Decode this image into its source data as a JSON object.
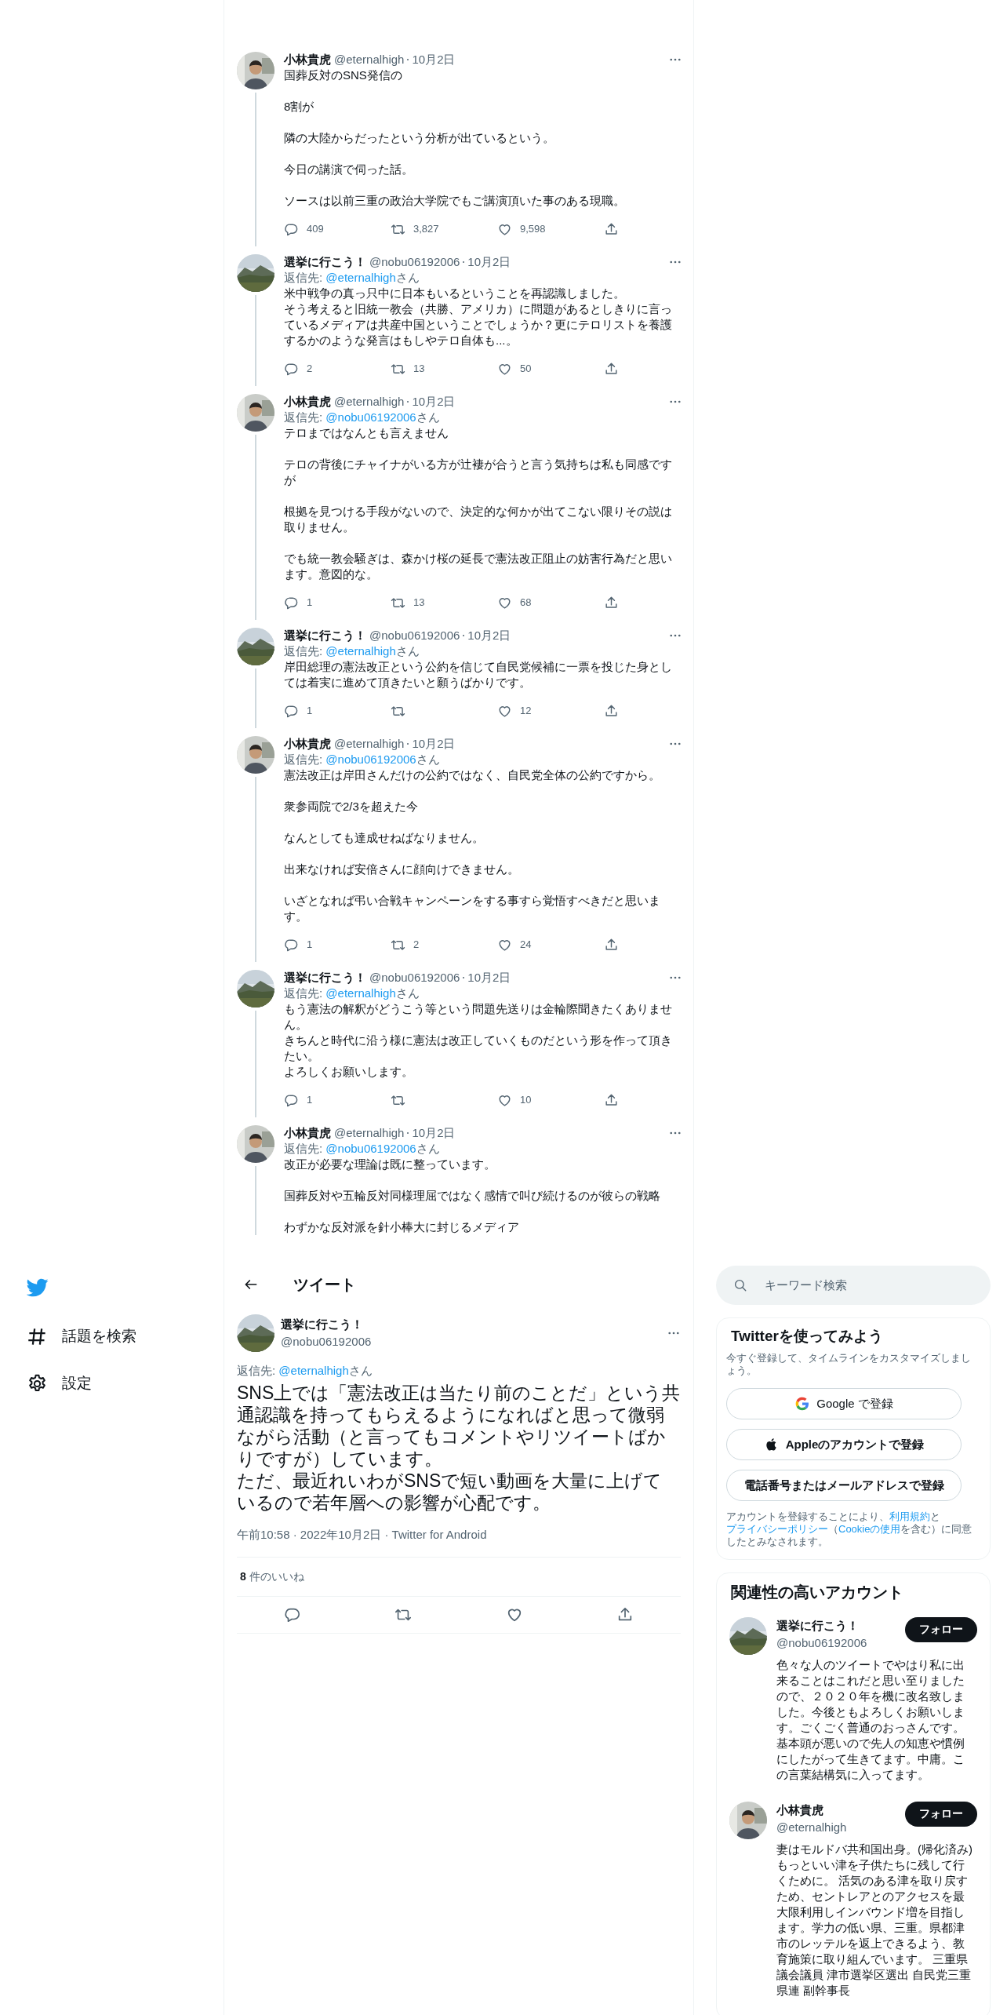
{
  "thread": [
    {
      "author": "小林貴虎",
      "handle": "@eternalhigh",
      "date": "10月2日",
      "paragraphs": [
        [
          "国葬反対のSNS発信の"
        ],
        [
          "8割が"
        ],
        [
          "隣の大陸からだったという分析が出ているという。"
        ],
        [
          "今日の講演で伺った話。"
        ],
        [
          "ソースは以前三重の政治大学院でもご講演頂いた事のある現職。"
        ]
      ],
      "stats": {
        "replies": "409",
        "retweets": "3,827",
        "likes": "9,598"
      }
    },
    {
      "author": "選挙に行こう！",
      "handle": "@nobu06192006",
      "date": "10月2日",
      "reply_to": {
        "prefix": "返信先: ",
        "handle": "@eternalhigh",
        "suffix": "さん"
      },
      "paragraphs": [
        [
          "米中戦争の真っ只中に日本もいるということを再認識しました。",
          "そう考えると旧統一教会（共勝、アメリカ）に問題があるとしきりに言っているメディアは共産中国ということでしょうか？更にテロリストを養護するかのような発言はもしやテロ自体も...。"
        ]
      ],
      "stats": {
        "replies": "2",
        "retweets": "13",
        "likes": "50"
      }
    },
    {
      "author": "小林貴虎",
      "handle": "@eternalhigh",
      "date": "10月2日",
      "reply_to": {
        "prefix": "返信先: ",
        "handle": "@nobu06192006",
        "suffix": "さん"
      },
      "paragraphs": [
        [
          "テロまではなんとも言えません"
        ],
        [
          "テロの背後にチャイナがいる方が辻褄が合うと言う気持ちは私も同感ですが"
        ],
        [
          "根拠を見つける手段がないので、決定的な何かが出てこない限りその説は取りません。"
        ],
        [
          "でも統一教会騒ぎは、森かけ桜の延長で憲法改正阻止の妨害行為だと思います。意図的な。"
        ]
      ],
      "stats": {
        "replies": "1",
        "retweets": "13",
        "likes": "68"
      }
    },
    {
      "author": "選挙に行こう！",
      "handle": "@nobu06192006",
      "date": "10月2日",
      "reply_to": {
        "prefix": "返信先: ",
        "handle": "@eternalhigh",
        "suffix": "さん"
      },
      "paragraphs": [
        [
          "岸田総理の憲法改正という公約を信じて自民党候補に一票を投じた身としては着実に進めて頂きたいと願うばかりです。"
        ]
      ],
      "stats": {
        "replies": "1",
        "likes": "12"
      }
    },
    {
      "author": "小林貴虎",
      "handle": "@eternalhigh",
      "date": "10月2日",
      "reply_to": {
        "prefix": "返信先: ",
        "handle": "@nobu06192006",
        "suffix": "さん"
      },
      "paragraphs": [
        [
          "憲法改正は岸田さんだけの公約ではなく、自民党全体の公約ですから。"
        ],
        [
          "衆参両院で2/3を超えた今"
        ],
        [
          "なんとしても達成せねばなりません。"
        ],
        [
          "出来なければ安倍さんに顔向けできません。"
        ],
        [
          "いざとなれば弔い合戦キャンペーンをする事すら覚悟すべきだと思います。"
        ]
      ],
      "stats": {
        "replies": "1",
        "retweets": "2",
        "likes": "24"
      }
    },
    {
      "author": "選挙に行こう！",
      "handle": "@nobu06192006",
      "date": "10月2日",
      "reply_to": {
        "prefix": "返信先: ",
        "handle": "@eternalhigh",
        "suffix": "さん"
      },
      "paragraphs": [
        [
          "もう憲法の解釈がどうこう等という問題先送りは金輪際聞きたくありません。",
          "きちんと時代に沿う様に憲法は改正していくものだという形を作って頂きたい。",
          "よろしくお願いします。"
        ]
      ],
      "stats": {
        "replies": "1",
        "likes": "10"
      }
    },
    {
      "author": "小林貴虎",
      "handle": "@eternalhigh",
      "date": "10月2日",
      "reply_to": {
        "prefix": "返信先: ",
        "handle": "@nobu06192006",
        "suffix": "さん"
      },
      "paragraphs": [
        [
          "改正が必要な理論は既に整っています。"
        ],
        [
          "国葬反対や五輪反対同様理屈ではなく感情で叫び続けるのが彼らの戦略"
        ],
        [
          "わずかな反対派を針小棒大に封じるメディア"
        ]
      ]
    }
  ],
  "nav": {
    "items": [
      {
        "kind": "hash",
        "label": "話題を検索"
      },
      {
        "kind": "gear",
        "label": "設定"
      }
    ]
  },
  "header": {
    "title": "ツイート"
  },
  "main_tweet": {
    "author": "選挙に行こう！",
    "handle": "@nobu06192006",
    "reply_to": {
      "prefix": "返信先: ",
      "handle": "@eternalhigh",
      "suffix": "さん"
    },
    "lines": [
      "SNS上では「憲法改正は当たり前のことだ」という共通認識を持ってもらえるようになればと思って微弱ながら活動（と言ってもコメントやリツイートばかりですが）しています。",
      "ただ、最近れいわがSNSで短い動画を大量に上げているので若年層への影響が心配です。"
    ],
    "meta": "午前10:58 · 2022年10月2日 · Twitter for Android",
    "likes": "**8** 件のいいね"
  },
  "search": {
    "placeholder": "キーワード検索"
  },
  "signup": {
    "title": "Twitterを使ってみよう",
    "subtitle": "今すぐ登録して、タイムラインをカスタマイズしましょう。",
    "buttons": [
      {
        "kind": "google",
        "label": "Google で登録"
      },
      {
        "kind": "apple",
        "label": "Appleのアカウントで登録"
      },
      {
        "kind": "plain",
        "label": "電話番号またはメールアドレスで登録"
      }
    ],
    "legal": [
      {
        "text": "アカウントを登録することにより、",
        "link": false
      },
      {
        "text": "利用規約",
        "link": true
      },
      {
        "text": "と",
        "link": false
      },
      {
        "text": "プライバシーポリシー",
        "link": true
      },
      {
        "text": "（",
        "link": false
      },
      {
        "text": "Cookieの使用",
        "link": true
      },
      {
        "text": "を含む）に同意したとみなされます。",
        "link": false
      }
    ]
  },
  "related": {
    "title": "関連性の高いアカウント",
    "accounts": [
      {
        "name": "選挙に行こう！",
        "handle": "@nobu06192006",
        "button": "フォロー",
        "bio": "色々な人のツイートでやはり私に出来ることはこれだと思い至りましたので、２０２０年を機に改名致しました。今後ともよろしくお願いします。ごくごく普通のおっさんです。基本頭が悪いので先人の知恵や慣例にしたがって生きてます。中庸。この言葉結構気に入ってます。"
      },
      {
        "name": "小林貴虎",
        "handle": "@eternalhigh",
        "button": "フォロー",
        "bio": "妻はモルドバ共和国出身。(帰化済み) もっといい津を子供たちに残して行くために。 活気のある津を取り戻すため、セントレアとのアクセスを最大限利用しインバウンド増を目指します。学力の低い県、三重。県都津市のレッテルを返上できるよう、教育施策に取り組んでいます。 三重県議会議員 津市選挙区選出 自民党三重県連 副幹事長"
      }
    ]
  }
}
